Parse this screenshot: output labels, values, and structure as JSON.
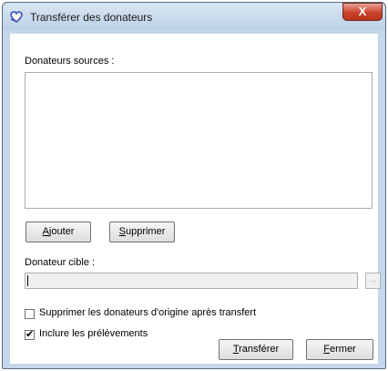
{
  "window": {
    "title": "Transférer des donateurs",
    "close_glyph": "X",
    "icon": "heart-hands-icon"
  },
  "sources": {
    "label": "Donateurs sources :",
    "items": []
  },
  "buttons": {
    "add_label_prefix": "",
    "add_mnemonic": "A",
    "add_label_rest": "jouter",
    "delete_mnemonic": "S",
    "delete_label_rest": "upprimer",
    "transfer_mnemonic": "T",
    "transfer_label_rest": "ransférer",
    "close_mnemonic": "F",
    "close_label_rest": "ermer",
    "browse_label": "..."
  },
  "target": {
    "label": "Donateur cible :",
    "value": ""
  },
  "options": {
    "delete_original": {
      "label": "Supprimer les donateurs d'origine après transfert",
      "checked": false
    },
    "include_withdrawals": {
      "label": "Inclure les prélèvements",
      "checked": true
    }
  }
}
